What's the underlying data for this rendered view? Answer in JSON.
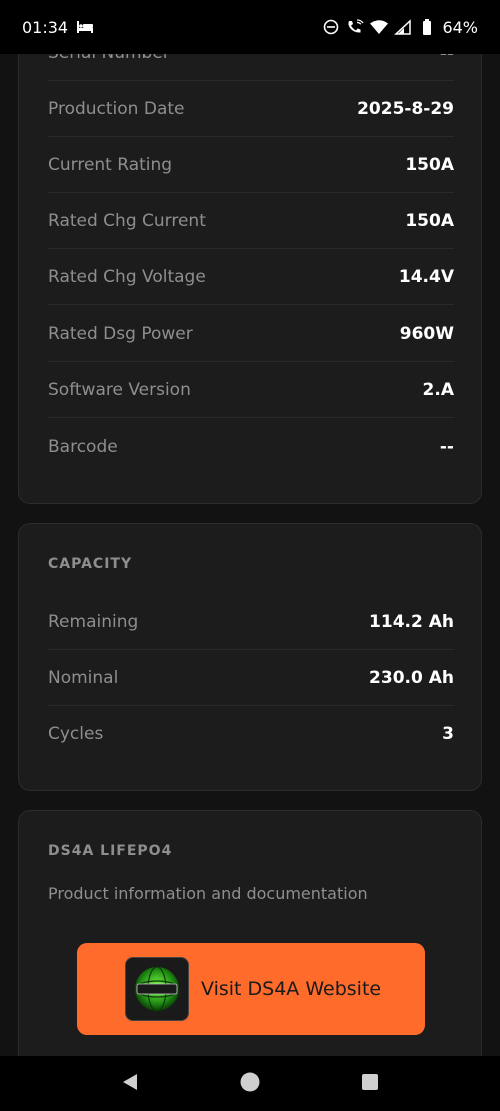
{
  "status_bar": {
    "time": "01:34",
    "battery": "64%"
  },
  "device_info": {
    "partial_label": "Serial Number",
    "partial_value": "--",
    "rows": [
      {
        "label": "Production Date",
        "value": "2025-8-29"
      },
      {
        "label": "Current Rating",
        "value": "150A"
      },
      {
        "label": "Rated Chg Current",
        "value": "150A"
      },
      {
        "label": "Rated Chg Voltage",
        "value": "14.4V"
      },
      {
        "label": "Rated Dsg Power",
        "value": "960W"
      },
      {
        "label": "Software Version",
        "value": "2.A"
      },
      {
        "label": "Barcode",
        "value": "--"
      }
    ]
  },
  "capacity": {
    "title": "CAPACITY",
    "rows": [
      {
        "label": "Remaining",
        "value": "114.2 Ah"
      },
      {
        "label": "Nominal",
        "value": "230.0 Ah"
      },
      {
        "label": "Cycles",
        "value": "3"
      }
    ]
  },
  "product": {
    "title": "DS4A LIFEPO4",
    "description": "Product information and documentation",
    "button_label": "Visit DS4A Website"
  },
  "colors": {
    "background": "#121212",
    "card": "#1c1c1c",
    "accent": "#ff6b2b",
    "label": "#8e8e8e"
  },
  "icons": {
    "status_left": "bed-icon",
    "status_right": [
      "do-not-disturb-icon",
      "wifi-call-icon",
      "wifi-icon",
      "signal-icon",
      "battery-icon"
    ],
    "nav": [
      "back-icon",
      "home-icon",
      "recents-icon"
    ]
  }
}
